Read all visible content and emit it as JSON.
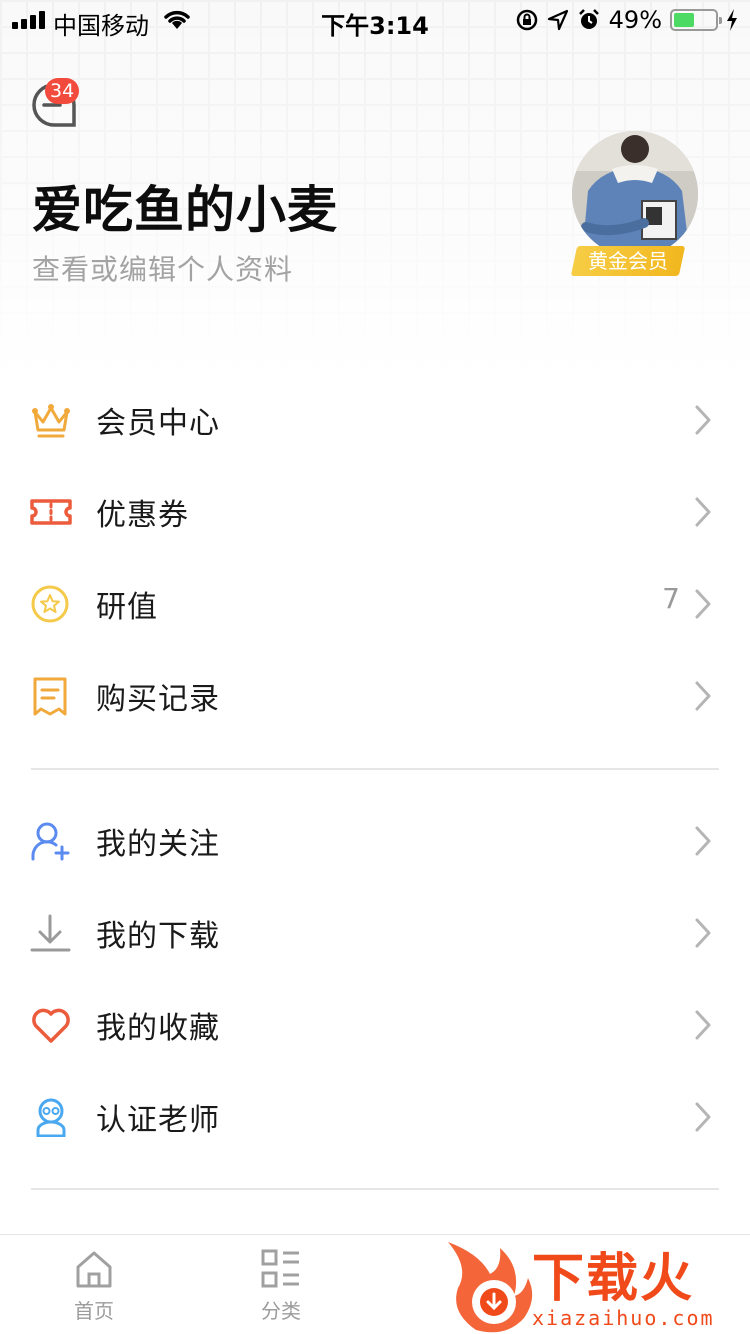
{
  "status_bar": {
    "carrier": "中国移动",
    "time": "下午3:14",
    "battery_percent": "49%",
    "battery_level": 0.49,
    "icons": [
      "signal-icon",
      "wifi-icon",
      "orientation-lock-icon",
      "location-icon",
      "alarm-icon",
      "battery-icon",
      "charging-icon"
    ]
  },
  "header": {
    "message_badge_count": "34",
    "user_name": "爱吃鱼的小麦",
    "edit_profile_link": "查看或编辑个人资料",
    "member_badge": "黄金会员"
  },
  "menu_group_1": [
    {
      "label": "会员中心",
      "icon": "crown-icon",
      "color": "#f2a93b",
      "value": ""
    },
    {
      "label": "优惠券",
      "icon": "coupon-icon",
      "color": "#ec5b3b",
      "value": ""
    },
    {
      "label": "研值",
      "icon": "star-coin-icon",
      "color": "#f5c94a",
      "value": "7"
    },
    {
      "label": "购买记录",
      "icon": "receipt-icon",
      "color": "#f2a93b",
      "value": ""
    }
  ],
  "menu_group_2": [
    {
      "label": "我的关注",
      "icon": "add-user-icon",
      "color": "#5b8bf0",
      "value": ""
    },
    {
      "label": "我的下载",
      "icon": "download-icon",
      "color": "#9a9a9a",
      "value": ""
    },
    {
      "label": "我的收藏",
      "icon": "heart-icon",
      "color": "#ec5b3b",
      "value": ""
    },
    {
      "label": "认证老师",
      "icon": "teacher-icon",
      "color": "#4aa8f0",
      "value": ""
    }
  ],
  "tab_bar": {
    "tabs": [
      {
        "label": "首页",
        "icon": "home-icon"
      },
      {
        "label": "分类",
        "icon": "category-icon"
      }
    ]
  },
  "watermark": {
    "text": "下载火",
    "url": "xiazaihuo.com"
  },
  "colors": {
    "accent_orange": "#f2a93b",
    "badge_red": "#f24a3d",
    "gold": "#f2b71f"
  }
}
